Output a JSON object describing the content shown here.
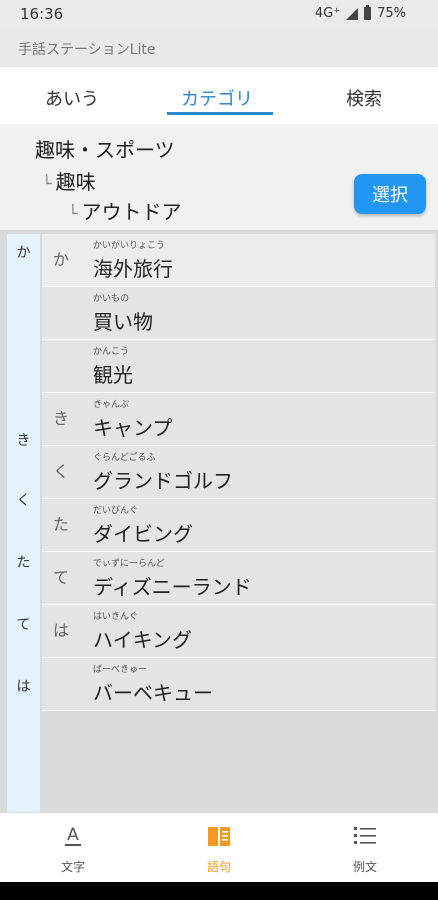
{
  "status": {
    "time": "16:36",
    "network": "4G⁺",
    "battery": "75%"
  },
  "app": {
    "title": "手話ステーションLite"
  },
  "tabs": [
    {
      "label": "あいう"
    },
    {
      "label": "カテゴリ"
    },
    {
      "label": "検索"
    }
  ],
  "active_tab": 1,
  "breadcrumb": {
    "level1": "趣味・スポーツ",
    "level2": "趣味",
    "level3": "アウトドア",
    "tick": "└"
  },
  "select_button": {
    "label": "選択"
  },
  "index_letters": [
    "か",
    "き",
    "く",
    "た",
    "て",
    "は"
  ],
  "words": [
    {
      "initial": "か",
      "reading": "かいがいりょこう",
      "word": "海外旅行"
    },
    {
      "initial": "",
      "reading": "かいもの",
      "word": "買い物"
    },
    {
      "initial": "",
      "reading": "かんこう",
      "word": "観光"
    },
    {
      "initial": "き",
      "reading": "きゃんぷ",
      "word": "キャンプ"
    },
    {
      "initial": "く",
      "reading": "ぐらんどごるふ",
      "word": "グランドゴルフ"
    },
    {
      "initial": "た",
      "reading": "だいびんぐ",
      "word": "ダイビング"
    },
    {
      "initial": "て",
      "reading": "でぃずにーらんど",
      "word": "ディズニーランド"
    },
    {
      "initial": "は",
      "reading": "はいきんぐ",
      "word": "ハイキング"
    },
    {
      "initial": "",
      "reading": "ばーべきゅー",
      "word": "バーベキュー"
    }
  ],
  "bottom_nav": [
    {
      "label": "文字",
      "icon": "text-icon"
    },
    {
      "label": "語句",
      "icon": "book-icon"
    },
    {
      "label": "例文",
      "icon": "list-icon"
    }
  ],
  "active_nav": 1,
  "colors": {
    "accent": "#2a86d6",
    "button": "#2196f3",
    "nav_active": "#f59a23",
    "index_bg": "#e3f2fd"
  }
}
